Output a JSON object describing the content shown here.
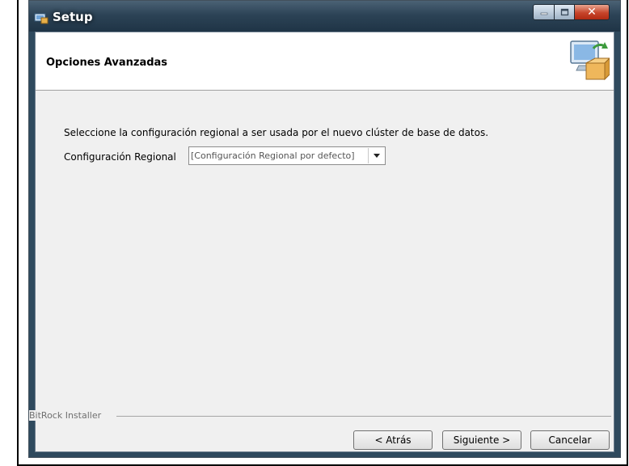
{
  "window": {
    "title": "Setup",
    "controls": {
      "minimize": "minimize",
      "maximize": "maximize",
      "close": "close"
    }
  },
  "header": {
    "title": "Opciones Avanzadas",
    "icon": "installer-box-icon"
  },
  "main": {
    "instruction": "Seleccione la configuración regional a ser usada por el nuevo clúster de base de datos.",
    "locale_label": "Configuración Regional",
    "locale_value": "[Configuración Regional por defecto]"
  },
  "footer": {
    "branding": "BitRock Installer",
    "back_label": "< Atrás",
    "next_label": "Siguiente >",
    "cancel_label": "Cancelar"
  },
  "colors": {
    "titlebar": "#2c4356",
    "client": "#f0f0f0",
    "close_button": "#c7452b"
  }
}
